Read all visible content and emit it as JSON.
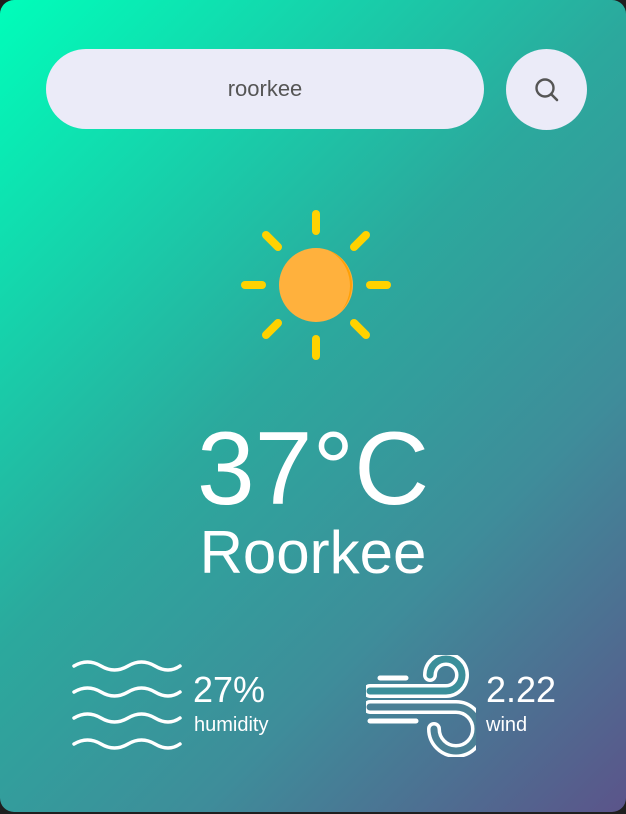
{
  "search": {
    "value": "roorkee",
    "button_icon": "search-icon"
  },
  "weather": {
    "icon": "sun-icon",
    "temperature": "37°C",
    "city": "Roorkee"
  },
  "humidity": {
    "icon": "humidity-waves-icon",
    "value": "27%",
    "label": "humidity"
  },
  "wind": {
    "icon": "wind-icon",
    "value": "2.22",
    "label": "wind"
  },
  "colors": {
    "gradient_start": "#00feba",
    "gradient_end": "#5b548a",
    "search_bg": "#ebebf8",
    "sun_body": "#ffb13d",
    "sun_rays": "#ffd200"
  }
}
